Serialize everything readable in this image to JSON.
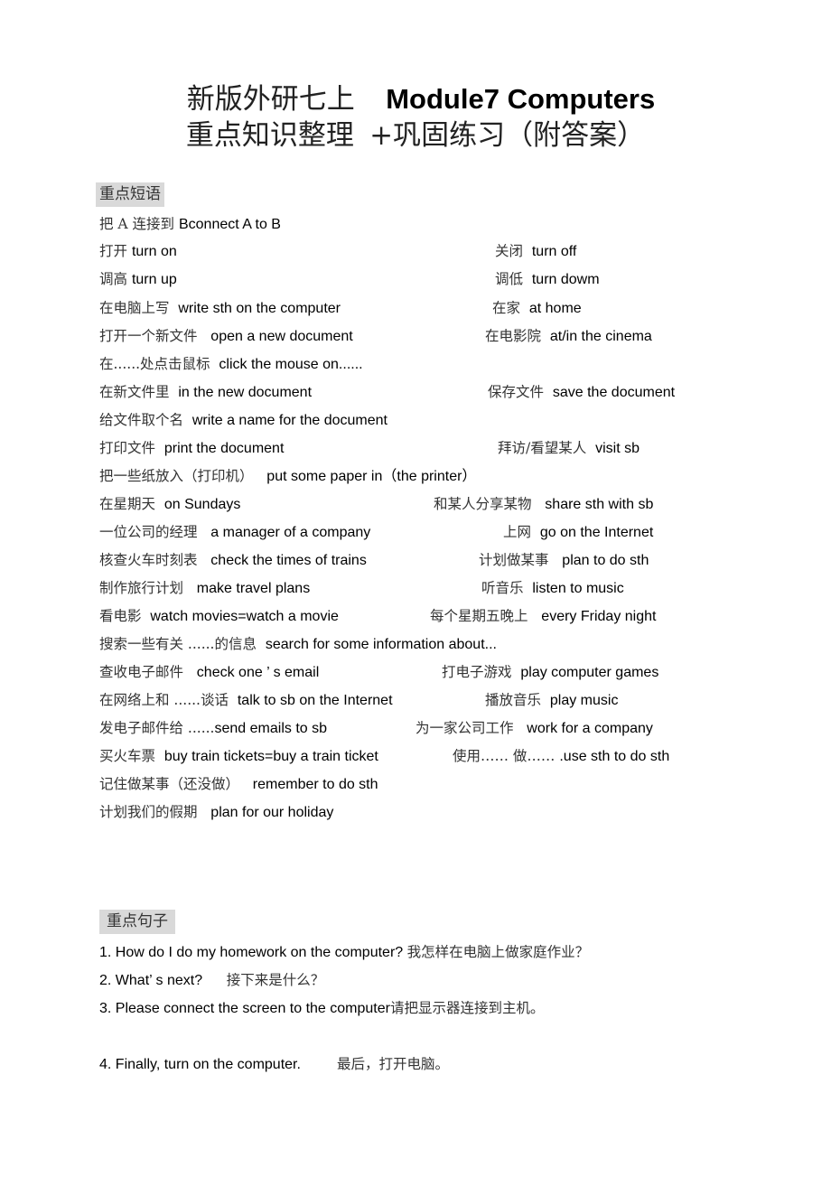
{
  "title": {
    "line1_cn": "新版外研七上",
    "line1_en": "Module7 Computers",
    "line2_cn": "重点知识整理",
    "line2_plus": "+巩固练习（附答案）"
  },
  "phrases_section": {
    "label": "重点短语",
    "rows": [
      {
        "left": {
          "cn": "把 A 连接到 ",
          "en": "Bconnect A to B"
        }
      },
      {
        "left": {
          "cn": "打开 ",
          "en": "turn on"
        },
        "right": {
          "cn": "关闭  ",
          "en": "turn off"
        }
      },
      {
        "left": {
          "cn": "调高 ",
          "en": "turn up"
        },
        "right": {
          "cn": "调低  ",
          "en": "turn dowm"
        }
      },
      {
        "left": {
          "cn": "在电脑上写  ",
          "en": "write sth on the computer"
        },
        "right": {
          "cn": "在家  ",
          "en": "at home"
        }
      },
      {
        "left": {
          "cn": "打开一个新文件   ",
          "en": "open a new document"
        },
        "right": {
          "cn": "在电影院  ",
          "en": "at/in the cinema"
        }
      },
      {
        "left": {
          "cn": "在......处点击鼠标  ",
          "en": "click the mouse on......"
        }
      },
      {
        "left": {
          "cn": "在新文件里  ",
          "en": "in the new document"
        },
        "right": {
          "cn": "保存文件  ",
          "en": "save the document"
        }
      },
      {
        "left": {
          "cn": "给文件取个名  ",
          "en": "write a name for the document"
        }
      },
      {
        "left": {
          "cn": "打印文件  ",
          "en": "print the document"
        },
        "right": {
          "cn": "拜访/看望某人  ",
          "en": "visit sb"
        }
      },
      {
        "left": {
          "cn": "把一些纸放入（打印机）   ",
          "en": "put some paper in（the printer）"
        }
      },
      {
        "left": {
          "cn": "在星期天  ",
          "en": "on Sundays"
        },
        "right": {
          "cn": "和某人分享某物   ",
          "en": "share sth with sb"
        }
      },
      {
        "left": {
          "cn": "一位公司的经理   ",
          "en": "a manager of a company"
        },
        "right": {
          "cn": "上网  ",
          "en": "go on the Internet"
        }
      },
      {
        "left": {
          "cn": "核查火车时刻表   ",
          "en": "check the times of trains"
        },
        "right": {
          "cn": "计划做某事   ",
          "en": "plan to do sth"
        }
      },
      {
        "left": {
          "cn": "制作旅行计划   ",
          "en": "make travel plans"
        },
        "right": {
          "cn": "听音乐  ",
          "en": "listen to music"
        }
      },
      {
        "left": {
          "cn": "看电影  ",
          "en": "watch movies=watch a movie"
        },
        "right": {
          "cn": "每个星期五晚上   ",
          "en": "every Friday night"
        }
      },
      {
        "left": {
          "cn": "搜索一些有关 ......的信息  ",
          "en": "search for some information about..."
        }
      },
      {
        "left": {
          "cn": "查收电子邮件   ",
          "en": "check one ’ s email"
        },
        "right": {
          "cn": "打电子游戏  ",
          "en": "play computer games"
        }
      },
      {
        "left": {
          "cn": "在网络上和 ......谈话  ",
          "en": "talk to sb on the Internet"
        },
        "right": {
          "cn": "播放音乐  ",
          "en": "play music"
        }
      },
      {
        "left": {
          "cn": "发电子邮件给 ......",
          "en": "send emails to sb"
        },
        "right": {
          "cn": "为一家公司工作   ",
          "en": "work for a company"
        }
      },
      {
        "left": {
          "cn": "买火车票  ",
          "en": "buy train tickets=buy a train ticket"
        },
        "right": {
          "cn": "使用…… 做…… ",
          "en": ".use sth to do sth"
        }
      },
      {
        "left": {
          "cn": "记住做某事（还没做）   ",
          "en": "remember to do sth"
        }
      },
      {
        "left": {
          "cn": "计划我们的假期   ",
          "en": "plan for our holiday"
        }
      }
    ]
  },
  "sentences_section": {
    "label": "重点句子",
    "items": [
      {
        "en": "1. How do I do my homework on the computer? ",
        "cn": "我怎样在电脑上做家庭作业？"
      },
      {
        "en": "2. What’ s next?      ",
        "cn": "接下来是什么？"
      },
      {
        "en": "3. Please connect the screen to the computer",
        "cn": "请把显示器连接到主机。"
      },
      {
        "en": "4. Finally, turn on the computer.         ",
        "cn": "最后，打开电脑。"
      }
    ]
  }
}
